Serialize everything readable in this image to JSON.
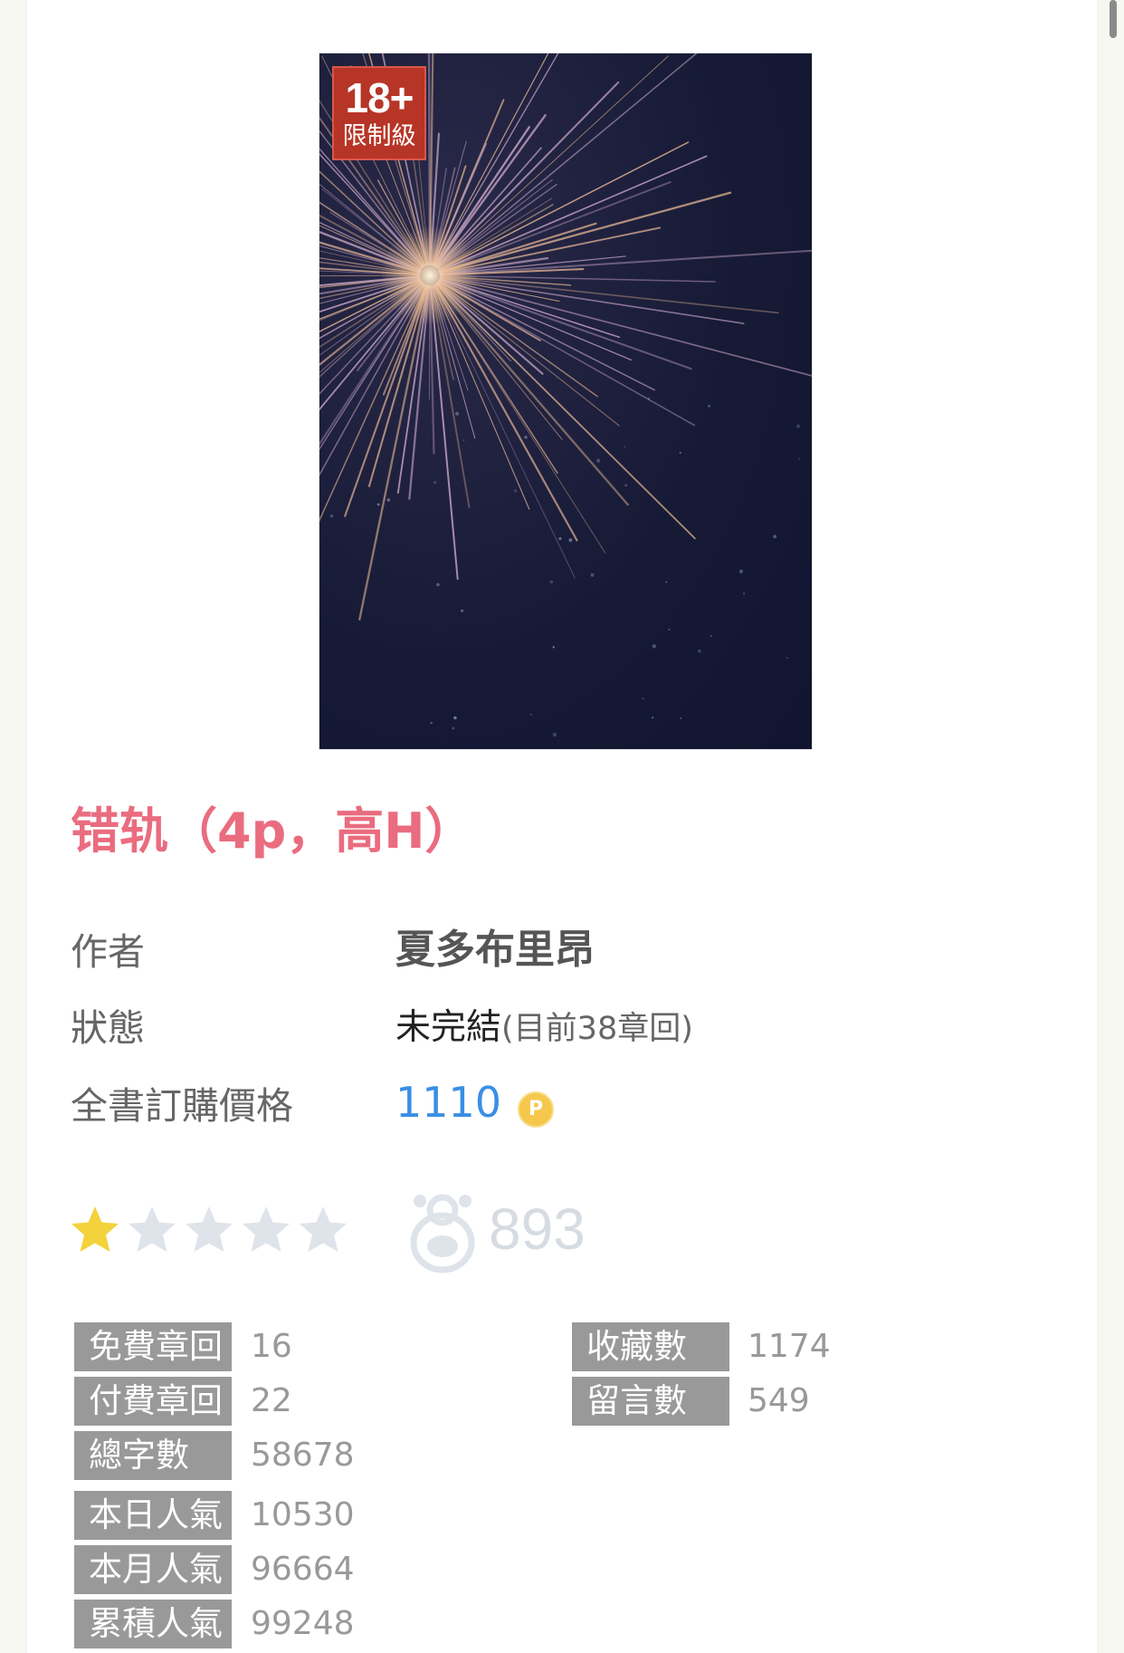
{
  "book": {
    "cover_badge": {
      "age": "18+",
      "label": "限制級"
    },
    "title": "错轨（4p，高H）"
  },
  "info": {
    "author_label": "作者",
    "author": "夏多布里昂",
    "status_label": "狀態",
    "status": "未完結",
    "status_detail": "(目前38章回)",
    "price_label": "全書訂購價格",
    "price": "1110",
    "price_icon": "coin-icon",
    "coin_letter": "P"
  },
  "rating": {
    "stars_filled": 1,
    "stars_total": 5,
    "star_color": "#f4d23c",
    "star_empty_color": "#dfe3ea",
    "reader_icon": "bear-reader-icon",
    "count": "893"
  },
  "stats_left": [
    {
      "label": "免費章回",
      "value": "16"
    },
    {
      "label": "付費章回",
      "value": "22"
    },
    {
      "label": "總字數",
      "value": "58678"
    },
    {
      "label": "本日人氣",
      "value": "10530"
    },
    {
      "label": "本月人氣",
      "value": "96664"
    },
    {
      "label": "累積人氣",
      "value": "99248"
    }
  ],
  "stats_right": [
    {
      "label": "收藏數",
      "value": "1174"
    },
    {
      "label": "留言數",
      "value": "549"
    }
  ],
  "colors": {
    "title": "#ea6c7f",
    "price": "#3a8ee6",
    "stat_label_bg": "#999999",
    "badge_bg": "#b73526"
  }
}
